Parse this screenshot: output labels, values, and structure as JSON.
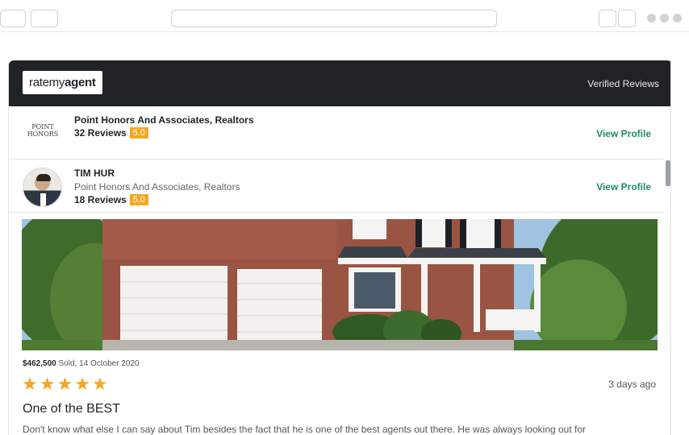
{
  "widget": {
    "logo": {
      "prefix": "rate",
      "middle": "my",
      "suffix": "agent"
    },
    "verified_label": "Verified Reviews",
    "agency_row": {
      "logo_text_line1": "POINT",
      "logo_text_line2": "HONORS",
      "name": "Point Honors And Associates, Realtors",
      "reviews": "32 Reviews",
      "score": "5.0",
      "link": "View Profile"
    },
    "agent_row": {
      "name": "TIM HUR",
      "agency": "Point Honors And Associates, Realtors",
      "reviews": "18 Reviews",
      "score": "5.0",
      "link": "View Profile"
    },
    "review": {
      "price": "$462,500",
      "sold_text": " Sold, 14 October 2020",
      "stars": [
        "★",
        "★",
        "★",
        "★",
        "★"
      ],
      "rating": 5,
      "ago": "3 days ago",
      "title": "One of the BEST",
      "body": "Don't know what else I can say about Tim besides the fact that he is one of the best agents out there. He was always looking out for"
    },
    "colors": {
      "header_bg": "#1f2326",
      "accent_green": "#1f8a6b",
      "score_bg": "#f5a623",
      "star": "#f5a623"
    }
  }
}
